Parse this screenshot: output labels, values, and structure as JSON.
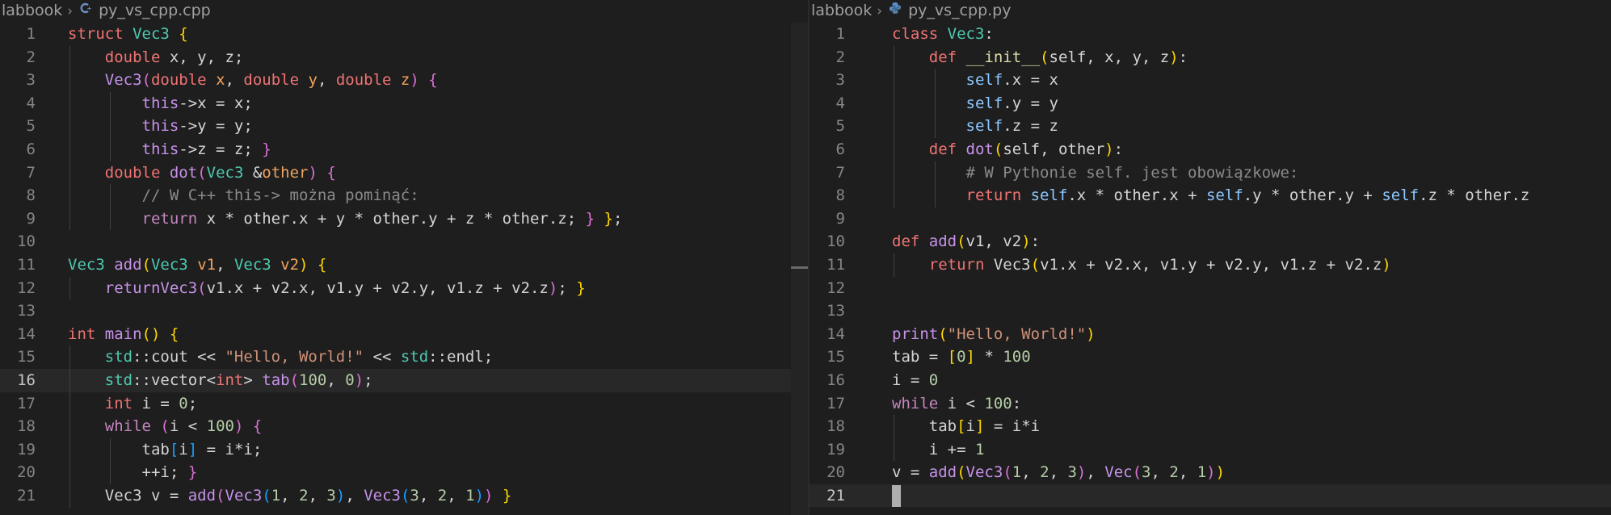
{
  "left": {
    "breadcrumb": {
      "folder": "labbook",
      "file": "py_vs_cpp.cpp",
      "file_icon": "cpp-file-icon"
    },
    "current_line": 16,
    "lines": [
      {
        "n": "1",
        "s": [
          [
            "kw",
            "struct "
          ],
          [
            "ty",
            "Vec3 "
          ],
          [
            "b1",
            "{"
          ]
        ]
      },
      {
        "n": "2",
        "s": [
          [
            "pl",
            "    "
          ],
          [
            "kw",
            "double "
          ],
          [
            "pl",
            "x, y, z;"
          ]
        ]
      },
      {
        "n": "3",
        "s": [
          [
            "pl",
            "    "
          ],
          [
            "fn2",
            "Vec3"
          ],
          [
            "b2",
            "("
          ],
          [
            "kw",
            "double "
          ],
          [
            "pm",
            "x"
          ],
          [
            "pl",
            ", "
          ],
          [
            "kw",
            "double "
          ],
          [
            "pm",
            "y"
          ],
          [
            "pl",
            ", "
          ],
          [
            "kw",
            "double "
          ],
          [
            "pm",
            "z"
          ],
          [
            "b2",
            ") {"
          ]
        ]
      },
      {
        "n": "4",
        "s": [
          [
            "pl",
            "        "
          ],
          [
            "fn2",
            "this"
          ],
          [
            "pl",
            "->x = x;"
          ]
        ]
      },
      {
        "n": "5",
        "s": [
          [
            "pl",
            "        "
          ],
          [
            "fn2",
            "this"
          ],
          [
            "pl",
            "->y = y;"
          ]
        ]
      },
      {
        "n": "6",
        "s": [
          [
            "pl",
            "        "
          ],
          [
            "fn2",
            "this"
          ],
          [
            "pl",
            "->z = z; "
          ],
          [
            "b2",
            "}"
          ]
        ]
      },
      {
        "n": "7",
        "s": [
          [
            "pl",
            "    "
          ],
          [
            "kw",
            "double "
          ],
          [
            "fn2",
            "dot"
          ],
          [
            "b2",
            "("
          ],
          [
            "ty",
            "Vec3 "
          ],
          [
            "pl",
            "&"
          ],
          [
            "pm",
            "other"
          ],
          [
            "b2",
            ") {"
          ]
        ]
      },
      {
        "n": "8",
        "s": [
          [
            "pl",
            "        "
          ],
          [
            "cm",
            "// W C++ this-> można pominąć:"
          ]
        ]
      },
      {
        "n": "9",
        "s": [
          [
            "pl",
            "        "
          ],
          [
            "ctl",
            "return "
          ],
          [
            "pl",
            "x * other.x + y * other.y + z * other.z; "
          ],
          [
            "b2",
            "} "
          ],
          [
            "b1",
            "}"
          ],
          [
            "pl",
            ";"
          ]
        ]
      },
      {
        "n": "10",
        "s": []
      },
      {
        "n": "11",
        "s": [
          [
            "ty",
            "Vec3 "
          ],
          [
            "fn2",
            "add"
          ],
          [
            "b1",
            "("
          ],
          [
            "ty",
            "Vec3 "
          ],
          [
            "pm",
            "v1"
          ],
          [
            "pl",
            ", "
          ],
          [
            "ty",
            "Vec3 "
          ],
          [
            "pm",
            "v2"
          ],
          [
            "b1",
            ") {"
          ]
        ]
      },
      {
        "n": "12",
        "s": [
          [
            "pl",
            "    "
          ],
          [
            "fn2",
            "returnVec3"
          ],
          [
            "b2",
            "("
          ],
          [
            "pl",
            "v1.x + v2.x, v1.y + v2.y, v1.z + v2.z"
          ],
          [
            "b2",
            ")"
          ],
          [
            "pl",
            "; "
          ],
          [
            "b1",
            "}"
          ]
        ]
      },
      {
        "n": "13",
        "s": []
      },
      {
        "n": "14",
        "s": [
          [
            "kw",
            "int "
          ],
          [
            "fn2",
            "main"
          ],
          [
            "b1",
            "() {"
          ]
        ]
      },
      {
        "n": "15",
        "s": [
          [
            "pl",
            "    "
          ],
          [
            "ns",
            "std"
          ],
          [
            "pl",
            "::cout << "
          ],
          [
            "st",
            "\"Hello, World!\""
          ],
          [
            "pl",
            " << "
          ],
          [
            "ns",
            "std"
          ],
          [
            "pl",
            "::endl;"
          ]
        ]
      },
      {
        "n": "16",
        "s": [
          [
            "pl",
            "    "
          ],
          [
            "ns",
            "std"
          ],
          [
            "pl",
            "::vector<"
          ],
          [
            "kw",
            "int"
          ],
          [
            "pl",
            "> "
          ],
          [
            "fn2",
            "tab"
          ],
          [
            "b2",
            "("
          ],
          [
            "nm",
            "100"
          ],
          [
            "pl",
            ", "
          ],
          [
            "nm",
            "0"
          ],
          [
            "b2",
            ")"
          ],
          [
            "pl",
            ";"
          ]
        ]
      },
      {
        "n": "17",
        "s": [
          [
            "pl",
            "    "
          ],
          [
            "kw",
            "int "
          ],
          [
            "pl",
            "i = "
          ],
          [
            "nm",
            "0"
          ],
          [
            "pl",
            ";"
          ]
        ]
      },
      {
        "n": "18",
        "s": [
          [
            "pl",
            "    "
          ],
          [
            "ctl",
            "while "
          ],
          [
            "b2",
            "("
          ],
          [
            "pl",
            "i < "
          ],
          [
            "nm",
            "100"
          ],
          [
            "b2",
            ") {"
          ]
        ]
      },
      {
        "n": "19",
        "s": [
          [
            "pl",
            "        tab"
          ],
          [
            "b3",
            "["
          ],
          [
            "pl",
            "i"
          ],
          [
            "b3",
            "]"
          ],
          [
            "pl",
            " = i*i;"
          ]
        ]
      },
      {
        "n": "20",
        "s": [
          [
            "pl",
            "        ++i; "
          ],
          [
            "b2",
            "}"
          ]
        ]
      },
      {
        "n": "21",
        "s": [
          [
            "pl",
            "    Vec3 v = "
          ],
          [
            "fn2",
            "add"
          ],
          [
            "b2",
            "("
          ],
          [
            "fn2",
            "Vec3"
          ],
          [
            "b3",
            "("
          ],
          [
            "nm",
            "1"
          ],
          [
            "pl",
            ", "
          ],
          [
            "nm",
            "2"
          ],
          [
            "pl",
            ", "
          ],
          [
            "nm",
            "3"
          ],
          [
            "b3",
            ")"
          ],
          [
            "pl",
            ", "
          ],
          [
            "fn2",
            "Vec3"
          ],
          [
            "b3",
            "("
          ],
          [
            "nm",
            "3"
          ],
          [
            "pl",
            ", "
          ],
          [
            "nm",
            "2"
          ],
          [
            "pl",
            ", "
          ],
          [
            "nm",
            "1"
          ],
          [
            "b3",
            ")"
          ],
          [
            "b2",
            ")"
          ],
          [
            "pl",
            " "
          ],
          [
            "b1",
            "}"
          ]
        ]
      }
    ]
  },
  "right": {
    "breadcrumb": {
      "folder": "labbook",
      "file": "py_vs_cpp.py",
      "file_icon": "python-file-icon"
    },
    "current_line": 21,
    "lines": [
      {
        "n": "1",
        "s": [
          [
            "kw",
            "class "
          ],
          [
            "ty",
            "Vec3"
          ],
          [
            "pl",
            ":"
          ]
        ]
      },
      {
        "n": "2",
        "s": [
          [
            "pl",
            "    "
          ],
          [
            "kw",
            "def "
          ],
          [
            "fn",
            "__init__"
          ],
          [
            "b1",
            "("
          ],
          [
            "pl",
            "self, x, y, z"
          ],
          [
            "b1",
            ")"
          ],
          [
            "pl",
            ":"
          ]
        ]
      },
      {
        "n": "3",
        "s": [
          [
            "pl",
            "        "
          ],
          [
            "sf",
            "self"
          ],
          [
            "pl",
            ".x = x"
          ]
        ]
      },
      {
        "n": "4",
        "s": [
          [
            "pl",
            "        "
          ],
          [
            "sf",
            "self"
          ],
          [
            "pl",
            ".y = y"
          ]
        ]
      },
      {
        "n": "5",
        "s": [
          [
            "pl",
            "        "
          ],
          [
            "sf",
            "self"
          ],
          [
            "pl",
            ".z = z"
          ]
        ]
      },
      {
        "n": "6",
        "s": [
          [
            "pl",
            "    "
          ],
          [
            "kw",
            "def "
          ],
          [
            "fn2",
            "dot"
          ],
          [
            "b1",
            "("
          ],
          [
            "pl",
            "self, other"
          ],
          [
            "b1",
            ")"
          ],
          [
            "pl",
            ":"
          ]
        ]
      },
      {
        "n": "7",
        "s": [
          [
            "pl",
            "        "
          ],
          [
            "cm",
            "# W Pythonie self. jest obowiązkowe:"
          ]
        ]
      },
      {
        "n": "8",
        "s": [
          [
            "pl",
            "        "
          ],
          [
            "kw",
            "return "
          ],
          [
            "sf",
            "self"
          ],
          [
            "pl",
            ".x * other.x + "
          ],
          [
            "sf",
            "self"
          ],
          [
            "pl",
            ".y * other.y + "
          ],
          [
            "sf",
            "self"
          ],
          [
            "pl",
            ".z * other.z"
          ]
        ]
      },
      {
        "n": "9",
        "s": []
      },
      {
        "n": "10",
        "s": [
          [
            "kw",
            "def "
          ],
          [
            "fn2",
            "add"
          ],
          [
            "b1",
            "("
          ],
          [
            "pl",
            "v1, v2"
          ],
          [
            "b1",
            ")"
          ],
          [
            "pl",
            ":"
          ]
        ]
      },
      {
        "n": "11",
        "s": [
          [
            "pl",
            "    "
          ],
          [
            "kw",
            "return "
          ],
          [
            "pl",
            "Vec3"
          ],
          [
            "b1",
            "("
          ],
          [
            "pl",
            "v1.x + v2.x, v1.y + v2.y, v1.z + v2.z"
          ],
          [
            "b1",
            ")"
          ]
        ]
      },
      {
        "n": "12",
        "s": []
      },
      {
        "n": "13",
        "s": []
      },
      {
        "n": "14",
        "s": [
          [
            "fn2",
            "print"
          ],
          [
            "b1",
            "("
          ],
          [
            "st",
            "\"Hello, World!\""
          ],
          [
            "b1",
            ")"
          ]
        ]
      },
      {
        "n": "15",
        "s": [
          [
            "pl",
            "tab = "
          ],
          [
            "b1",
            "["
          ],
          [
            "nm",
            "0"
          ],
          [
            "b1",
            "]"
          ],
          [
            "pl",
            " * "
          ],
          [
            "nm",
            "100"
          ]
        ]
      },
      {
        "n": "16",
        "s": [
          [
            "pl",
            "i = "
          ],
          [
            "nm",
            "0"
          ]
        ]
      },
      {
        "n": "17",
        "s": [
          [
            "ctl",
            "while "
          ],
          [
            "pl",
            "i < "
          ],
          [
            "nm",
            "100"
          ],
          [
            "pl",
            ":"
          ]
        ]
      },
      {
        "n": "18",
        "s": [
          [
            "pl",
            "    tab"
          ],
          [
            "b1",
            "["
          ],
          [
            "pl",
            "i"
          ],
          [
            "b1",
            "]"
          ],
          [
            "pl",
            " = i*i"
          ]
        ]
      },
      {
        "n": "19",
        "s": [
          [
            "pl",
            "    i += "
          ],
          [
            "nm",
            "1"
          ]
        ]
      },
      {
        "n": "20",
        "s": [
          [
            "pl",
            "v = "
          ],
          [
            "fn2",
            "add"
          ],
          [
            "b1",
            "("
          ],
          [
            "fn2",
            "Vec3"
          ],
          [
            "b2",
            "("
          ],
          [
            "nm",
            "1"
          ],
          [
            "pl",
            ", "
          ],
          [
            "nm",
            "2"
          ],
          [
            "pl",
            ", "
          ],
          [
            "nm",
            "3"
          ],
          [
            "b2",
            ")"
          ],
          [
            "pl",
            ", "
          ],
          [
            "fn2",
            "Vec"
          ],
          [
            "b2",
            "("
          ],
          [
            "nm",
            "3"
          ],
          [
            "pl",
            ", "
          ],
          [
            "nm",
            "2"
          ],
          [
            "pl",
            ", "
          ],
          [
            "nm",
            "1"
          ],
          [
            "b2",
            ")"
          ],
          [
            "b1",
            ")"
          ]
        ]
      },
      {
        "n": "21",
        "s": []
      }
    ]
  }
}
